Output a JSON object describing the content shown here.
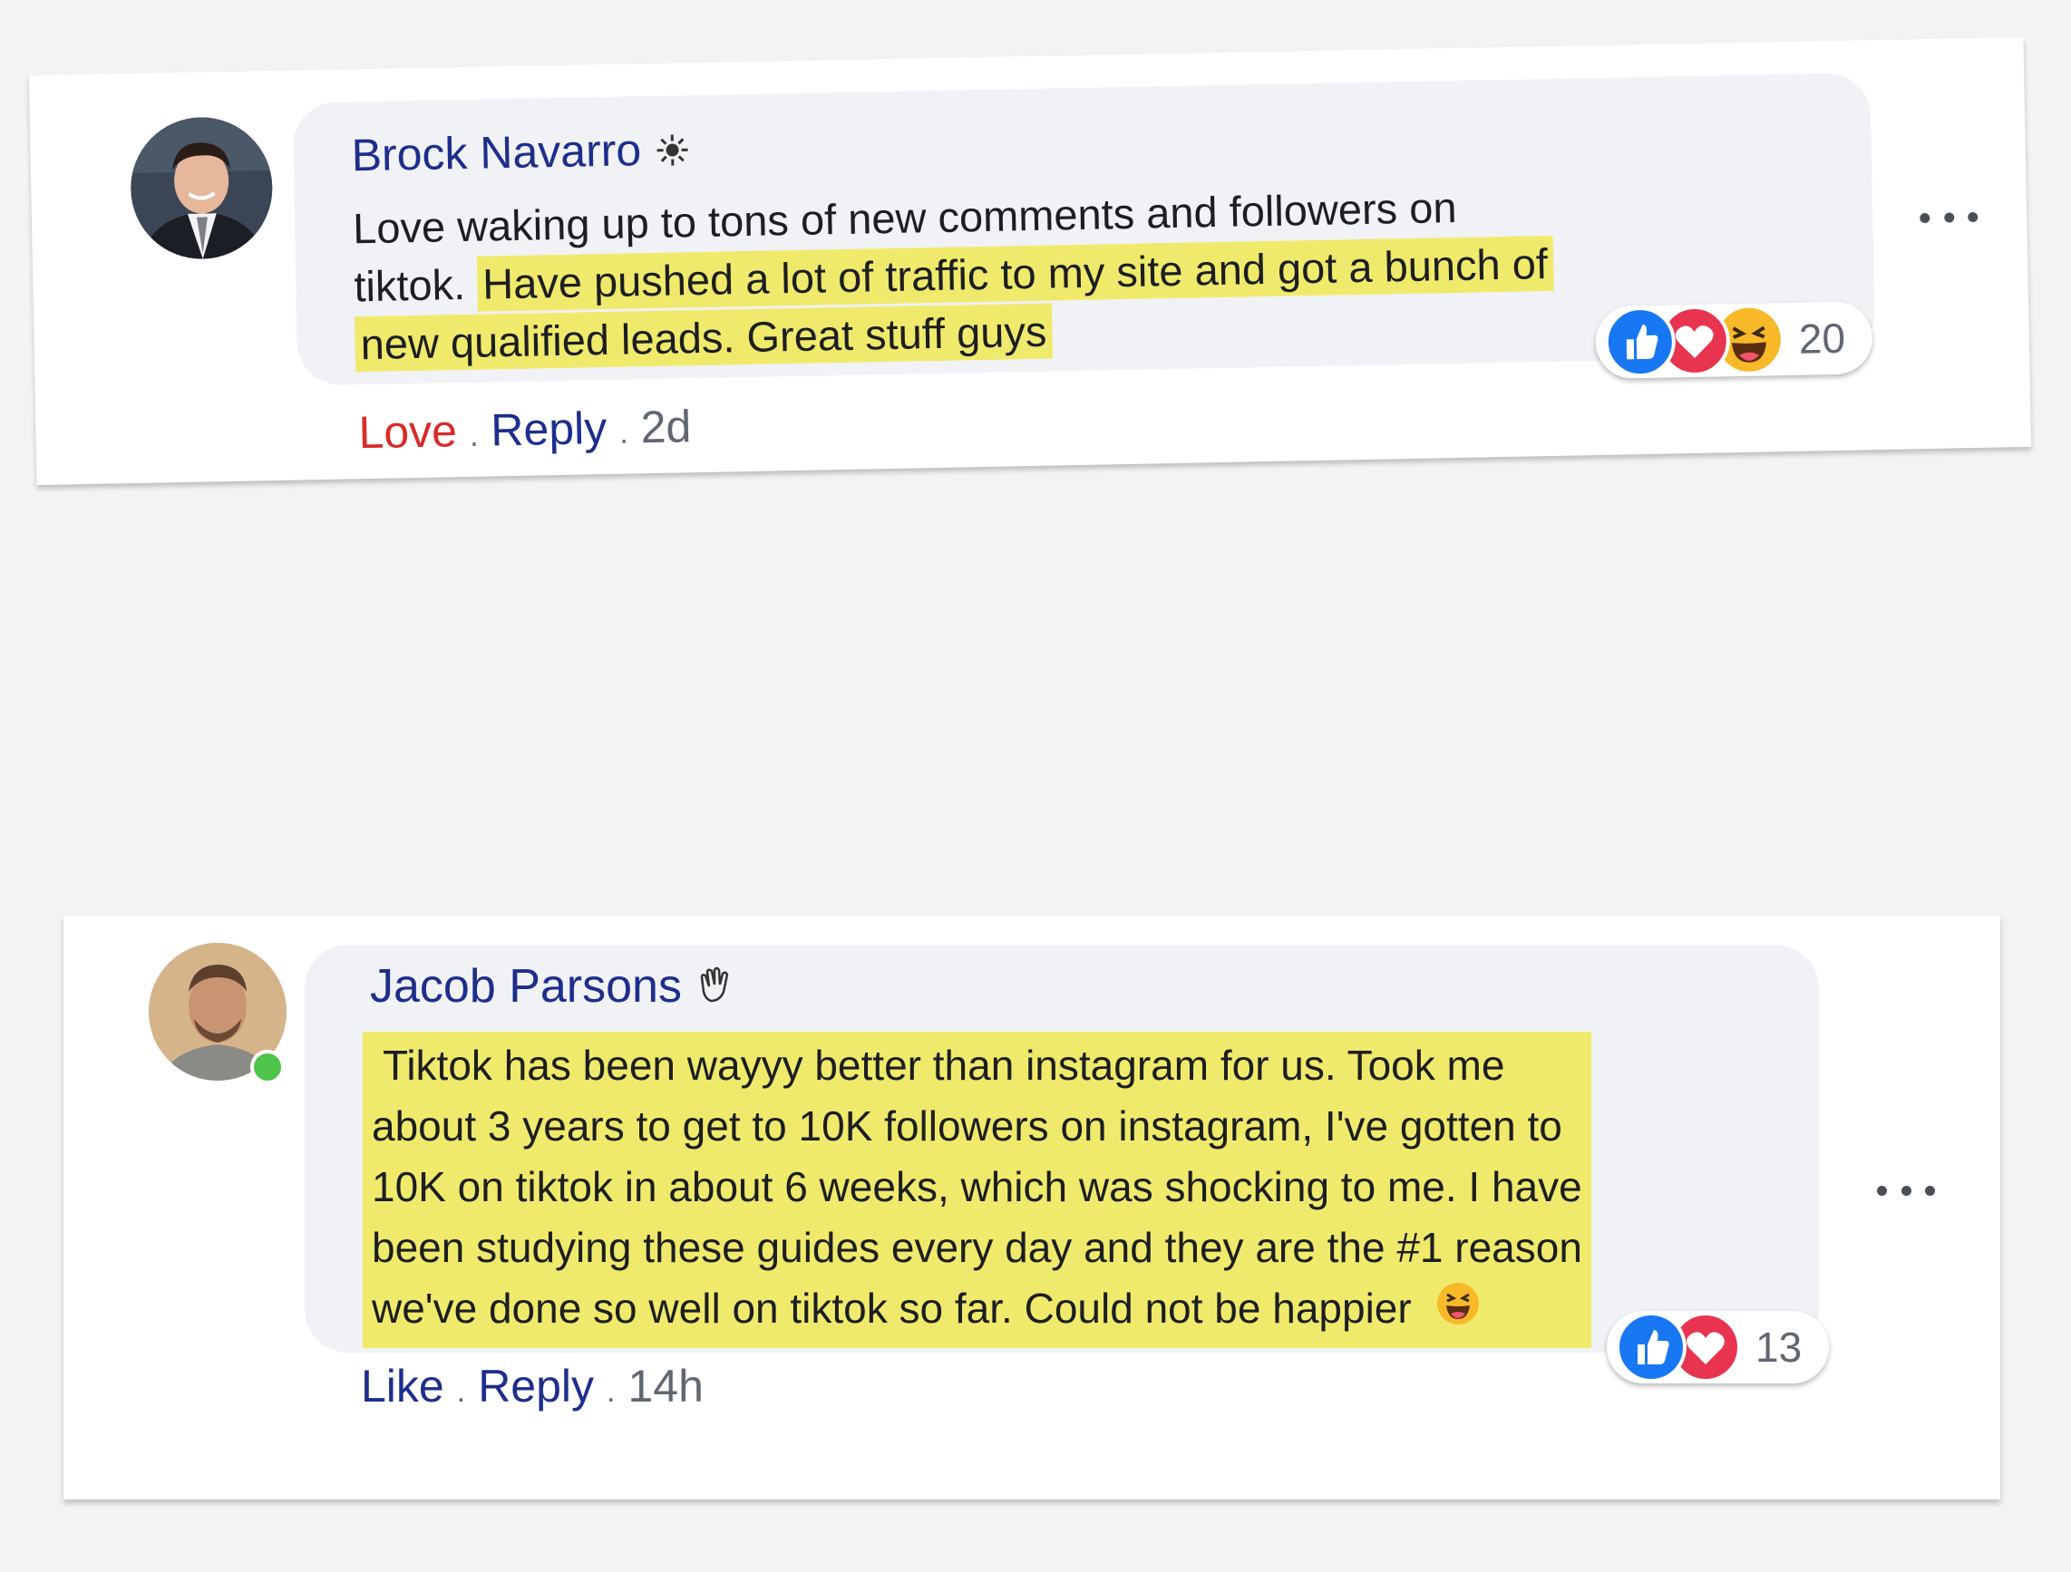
{
  "comments": [
    {
      "author": "Brock Navarro",
      "author_badge_icon": "sun-icon",
      "text": {
        "lines": [
          {
            "plain": "Love waking up to tons of new comments and followers on",
            "highlight": ""
          },
          {
            "plain": "tiktok.",
            "highlight": "Have pushed a lot of traffic to my site and got a bunch of"
          },
          {
            "plain": "",
            "highlight": "new qualified leads. Great stuff guys"
          }
        ]
      },
      "reactions": [
        "like-icon",
        "love-icon",
        "haha-icon"
      ],
      "reaction_count": "20",
      "action_reaction": "Love",
      "action_reply": "Reply",
      "separator": ".",
      "time": "2d"
    },
    {
      "author": "Jacob Parsons",
      "author_badge_icon": "waving-hand-icon",
      "online": true,
      "text": {
        "lines": [
          " Tiktok has been wayyy better than instagram for us. Took me",
          "about 3 years to get to 10K followers on instagram, I've gotten to",
          "10K on tiktok in about 6 weeks, which was shocking to me. I have",
          "been studying these guides every day and they are the #1 reason",
          "we've done so well on tiktok so far. Could not be happier"
        ],
        "trailing_emoji": "laughing-emoji"
      },
      "reactions": [
        "like-icon",
        "love-icon"
      ],
      "reaction_count": "13",
      "action_reaction": "Like",
      "action_reply": "Reply",
      "separator": ".",
      "time": "14h"
    }
  ],
  "colors": {
    "author_name": "#1d2e8c",
    "highlight": "#f0ea6c",
    "love_action": "#d82b2b",
    "bubble": "#f0f2f5",
    "like_reaction": "#1877f2",
    "love_reaction": "#e8344e",
    "haha_reaction": "#f7b928"
  }
}
